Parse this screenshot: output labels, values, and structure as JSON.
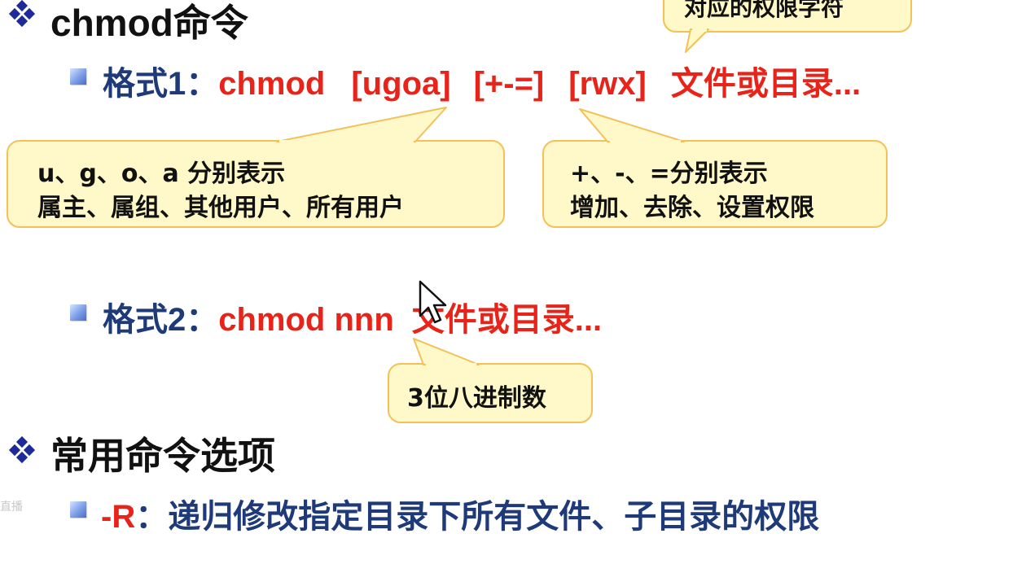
{
  "heading1": {
    "text": "chmod命令"
  },
  "callout_top": {
    "text": "对应的权限字符"
  },
  "format1": {
    "label": "格式1：",
    "cmd": "chmod",
    "who": "[ugoa]",
    "op": "[+-=]",
    "perm": "[rwx]",
    "target": "文件或目录..."
  },
  "callout_left": {
    "line1": "u、g、o、a 分别表示",
    "line2": "属主、属组、其他用户、所有用户"
  },
  "callout_right": {
    "line1": "+、-、=分别表示",
    "line2": "增加、去除、设置权限"
  },
  "format2": {
    "label": "格式2：",
    "cmd": "chmod nnn",
    "target": "文件或目录..."
  },
  "callout_octal": {
    "text": "3位八进制数"
  },
  "heading2": {
    "text": "常用命令选项"
  },
  "option_r": {
    "flag": "-R",
    "desc": "：递归修改指定目录下所有文件、子目录的权限"
  },
  "watermark": {
    "text": "直播"
  },
  "colors": {
    "heading": "#111111",
    "label_blue": "#1f3a78",
    "command_red": "#e8241a",
    "callout_fill": "#fff8c8",
    "callout_border": "#f2c15a"
  },
  "icons": [
    "diamond-bullet-icon",
    "square-bullet-icon",
    "mouse-cursor-icon"
  ]
}
